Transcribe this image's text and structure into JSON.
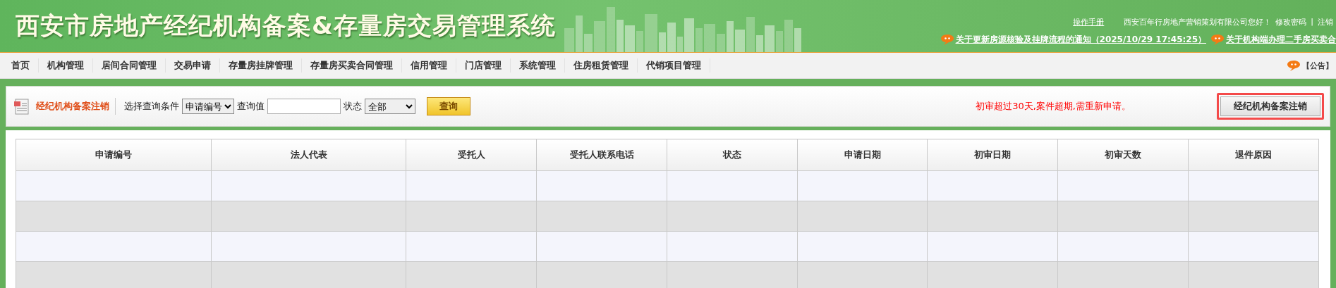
{
  "header": {
    "title": "西安市房地产经纪机构备案&存量房交易管理系统",
    "manual_link": "操作手册",
    "greeting": "西安百年行房地产营销策划有限公司您好！",
    "change_password_link": "修改密码",
    "separator": "|",
    "logout_link": "注销",
    "notices": [
      {
        "text": "关于更新房源核验及挂牌流程的通知（2025/10/29 17:45:25）"
      },
      {
        "text": "关于机构端办理二手房买卖合"
      }
    ]
  },
  "nav": {
    "items": [
      {
        "label": "首页"
      },
      {
        "label": "机构管理"
      },
      {
        "label": "居间合同管理"
      },
      {
        "label": "交易申请"
      },
      {
        "label": "存量房挂牌管理"
      },
      {
        "label": "存量房买卖合同管理"
      },
      {
        "label": "信用管理"
      },
      {
        "label": "门店管理"
      },
      {
        "label": "系统管理"
      },
      {
        "label": "住房租赁管理"
      },
      {
        "label": "代销项目管理"
      }
    ],
    "announcement": "【公告】"
  },
  "toolbar": {
    "title": "经纪机构备案注销",
    "condition_label": "选择查询条件",
    "condition_value": "申请编号",
    "query_label": "查询值",
    "status_label": "状态",
    "status_value": "全部",
    "search_button": "查询",
    "warning": "初审超过30天,案件超期,需重新申请。",
    "action_button": {
      "label": "经纪机构备案注销",
      "highlighted": true
    }
  },
  "table": {
    "columns": [
      "申请编号",
      "法人代表",
      "受托人",
      "受托人联系电话",
      "状态",
      "申请日期",
      "初审日期",
      "初审天数",
      "退件原因"
    ]
  }
}
